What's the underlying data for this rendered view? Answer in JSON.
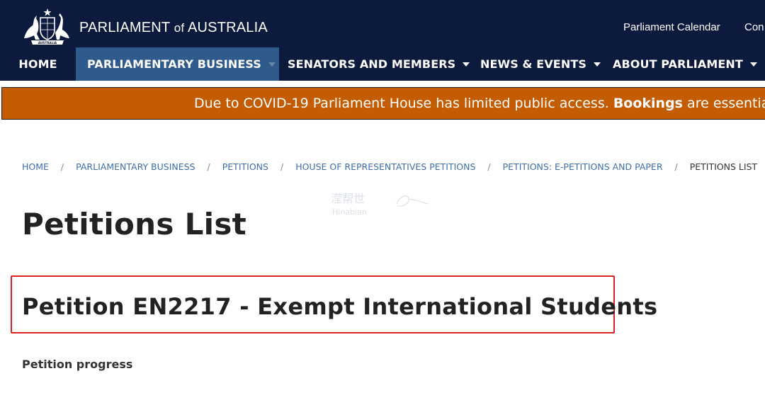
{
  "header": {
    "site_title_prefix": "PARLIAMENT",
    "site_title_of": "of",
    "site_title_suffix": "AUSTRALIA",
    "logo_label": "AUSTRALIA",
    "utility_links": [
      "Parliament Calendar",
      "Con"
    ]
  },
  "nav": {
    "items": [
      {
        "label": "HOME",
        "has_dropdown": false
      },
      {
        "label": "PARLIAMENTARY BUSINESS",
        "has_dropdown": true,
        "active": true
      },
      {
        "label": "SENATORS AND MEMBERS",
        "has_dropdown": true
      },
      {
        "label": "NEWS & EVENTS",
        "has_dropdown": true
      },
      {
        "label": "ABOUT PARLIAMENT",
        "has_dropdown": true
      }
    ]
  },
  "alert": {
    "text_before": "Due to COVID-19 Parliament House has limited public access.",
    "bold": "Bookings",
    "text_after": "are essential for a"
  },
  "breadcrumb": {
    "items": [
      "HOME",
      "PARLIAMENTARY BUSINESS",
      "PETITIONS",
      "HOUSE OF REPRESENTATIVES PETITIONS",
      "PETITIONS: E-PETITIONS AND PAPER"
    ],
    "current": "PETITIONS LIST"
  },
  "watermark": {
    "cn": "滢帮世",
    "en": "Hinabian"
  },
  "page": {
    "title": "Petitions List",
    "petition_heading": "Petition EN2217 - Exempt International Students",
    "progress_label": "Petition progress"
  },
  "colors": {
    "header_bg": "#0c1a3e",
    "nav_active_bg": "#2f5a8c",
    "alert_bg": "#c45c04",
    "link": "#3d6ea8",
    "highlight_box": "#e02020"
  }
}
